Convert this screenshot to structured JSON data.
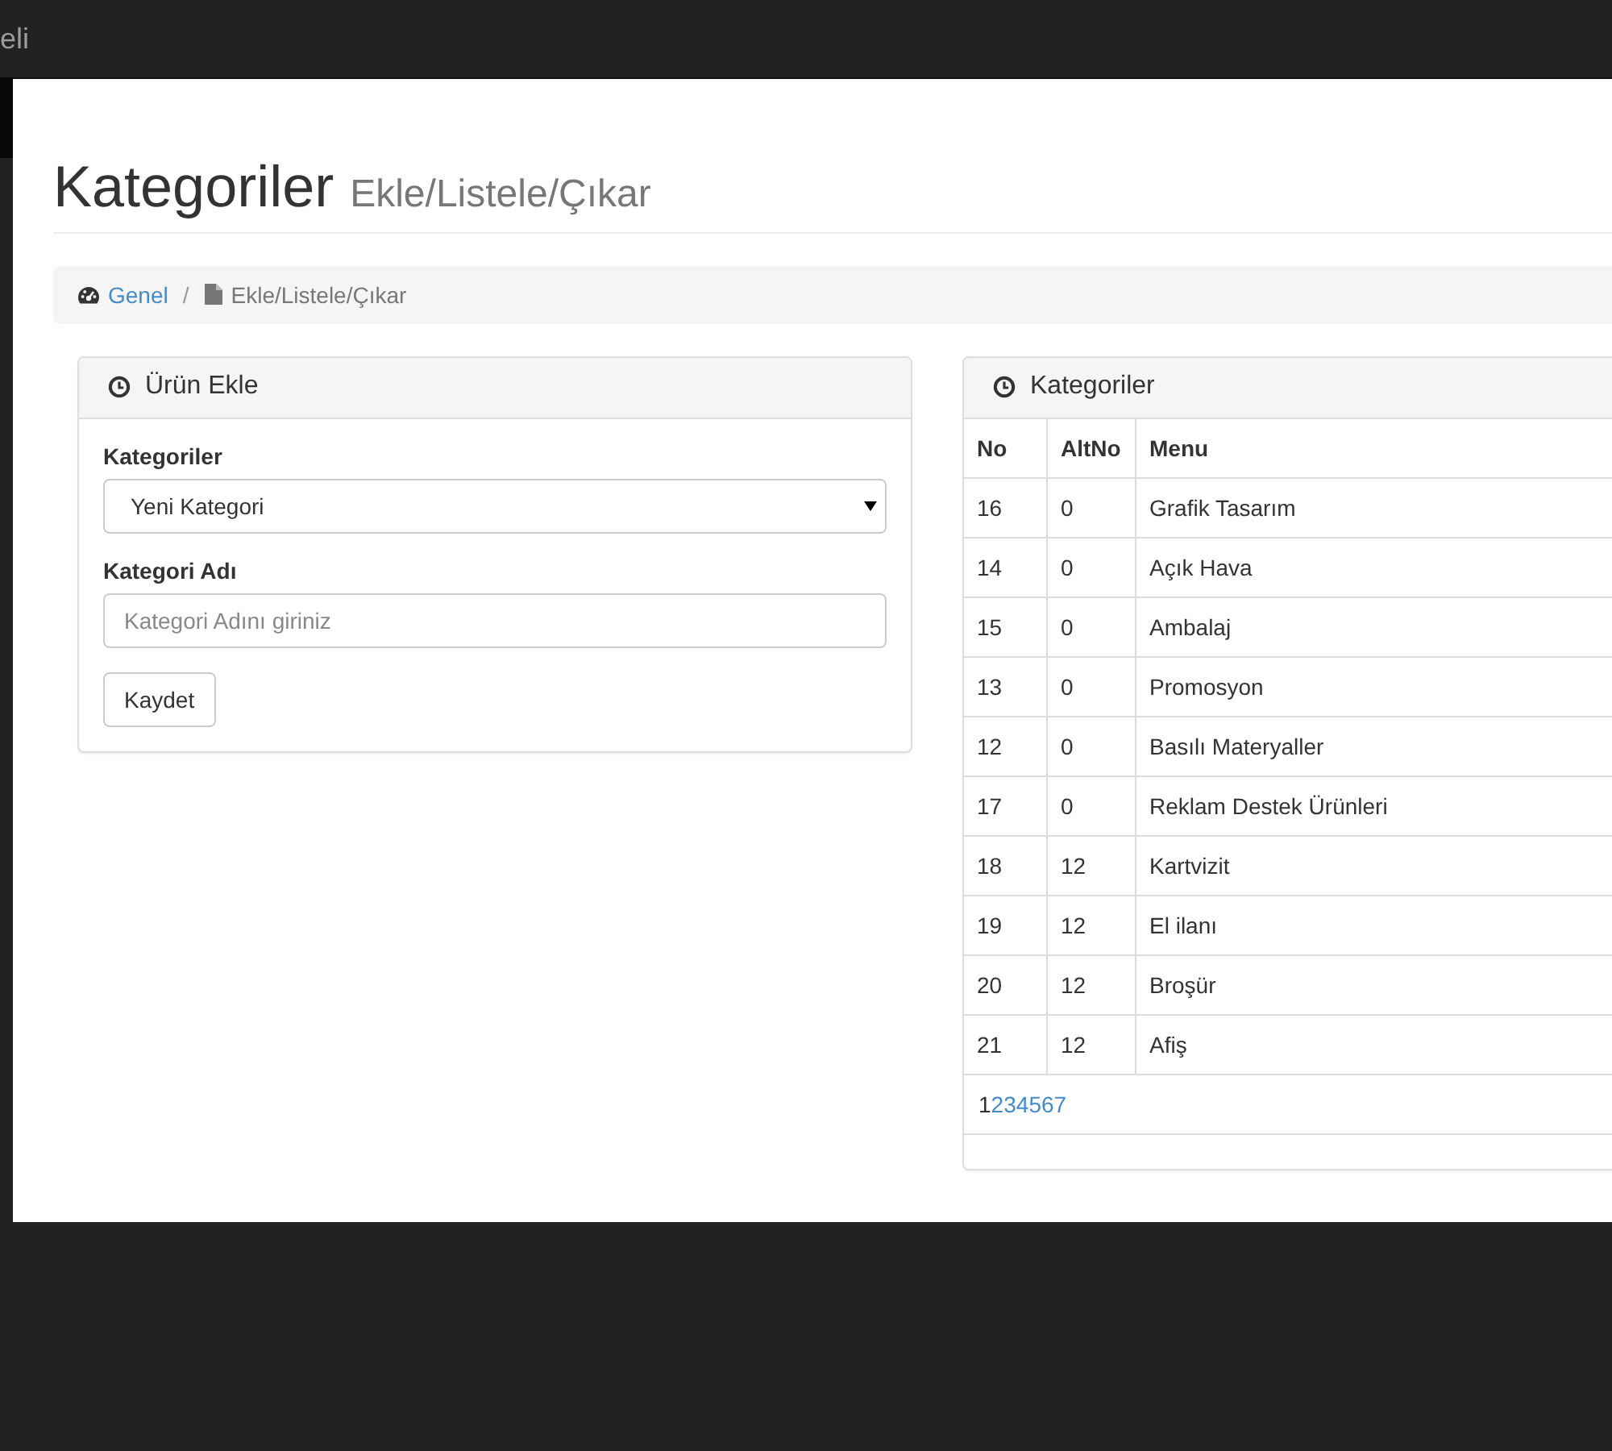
{
  "navbar": {
    "brand": "eli"
  },
  "page_header": {
    "title": "Kategoriler",
    "subtitle": "Ekle/Listele/Çıkar"
  },
  "breadcrumb_separator": "/",
  "breadcrumb": [
    {
      "label": "Genel",
      "active": false
    },
    {
      "label": "Ekle/Listele/Çıkar",
      "active": true
    }
  ],
  "form_panel": {
    "title": "Ürün Ekle",
    "fields": [
      {
        "kind": "select",
        "label": "Kategoriler",
        "value": "Yeni Kategori"
      },
      {
        "kind": "text",
        "label": "Kategori Adı",
        "placeholder": "Kategori Adını giriniz"
      }
    ],
    "button": "Kaydet"
  },
  "table_panel": {
    "title": "Kategoriler",
    "columns": [
      "No",
      "AltNo",
      "Menu"
    ],
    "rows": [
      [
        "16",
        "0",
        "Grafik Tasarım"
      ],
      [
        "14",
        "0",
        "Açık Hava"
      ],
      [
        "15",
        "0",
        "Ambalaj"
      ],
      [
        "13",
        "0",
        "Promosyon"
      ],
      [
        "12",
        "0",
        "Basılı Materyaller"
      ],
      [
        "17",
        "0",
        "Reklam Destek Ürünleri"
      ],
      [
        "18",
        "12",
        "Kartvizit"
      ],
      [
        "19",
        "12",
        "El ilanı"
      ],
      [
        "20",
        "12",
        "Broşür"
      ],
      [
        "21",
        "12",
        "Afiş"
      ]
    ],
    "pages": [
      {
        "label": "1",
        "selected": true
      },
      {
        "label": "2",
        "selected": false
      },
      {
        "label": "3",
        "selected": false
      },
      {
        "label": "4",
        "selected": false
      },
      {
        "label": "5",
        "selected": false
      },
      {
        "label": "6",
        "selected": false
      },
      {
        "label": "7",
        "selected": false
      }
    ]
  }
}
